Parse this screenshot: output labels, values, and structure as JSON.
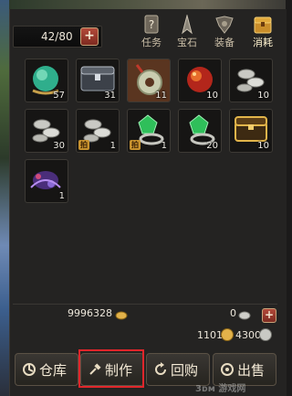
{
  "bag": {
    "capacity": "42/80",
    "capacity_plus": "+"
  },
  "tabs": [
    {
      "label": "任务",
      "icon": "quest-scroll-icon"
    },
    {
      "label": "宝石",
      "icon": "gem-icon"
    },
    {
      "label": "装备",
      "icon": "equipment-icon"
    },
    {
      "label": "消耗",
      "icon": "consumable-chest-icon",
      "active": true
    }
  ],
  "items": [
    {
      "icon": "crystal-orb-icon",
      "qty": "57",
      "bound": false
    },
    {
      "icon": "dark-chest-icon",
      "qty": "31",
      "bound": false
    },
    {
      "icon": "jade-pendant-icon",
      "qty": "11",
      "bound": false
    },
    {
      "icon": "fire-orb-icon",
      "qty": "10",
      "bound": false
    },
    {
      "icon": "silver-ingot-icon",
      "qty": "10",
      "bound": false
    },
    {
      "icon": "silver-ingot-icon",
      "qty": "30",
      "bound": false
    },
    {
      "icon": "silver-ingot-icon",
      "qty": "1",
      "bound": true
    },
    {
      "icon": "emerald-ring-icon",
      "qty": "1",
      "bound": true
    },
    {
      "icon": "emerald-ring-icon",
      "qty": "20",
      "bound": false
    },
    {
      "icon": "gold-treasure-box-icon",
      "qty": "10",
      "bound": false
    },
    {
      "icon": "purple-spirit-icon",
      "qty": "1",
      "bound": false
    }
  ],
  "bound_label": "拍",
  "currency": {
    "silver": "9996328",
    "bound_gold": "0",
    "gold": "1101",
    "diamond": "4300",
    "plus": "+"
  },
  "actions": {
    "warehouse": "仓库",
    "craft": "制作",
    "buyback": "回购",
    "sell": "出售"
  },
  "watermark": "3ᴅᴍ 游戏网",
  "colors": {
    "highlight": "#e0262b",
    "accent_red": "#b34a3a"
  }
}
